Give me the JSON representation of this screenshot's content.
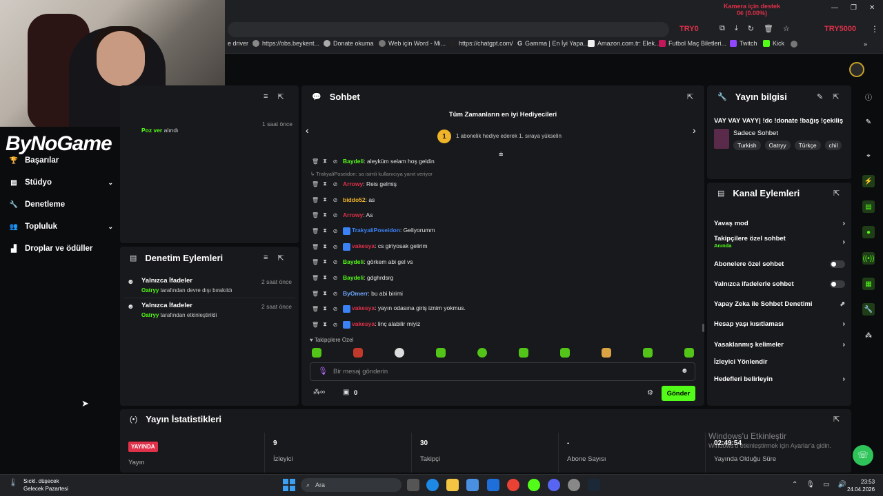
{
  "browser": {
    "notification_line1": "Kamera için destek",
    "notification_line2": "0¢ (0.00%)",
    "overlay_left": "TRY0",
    "overlay_right": "TRY5000",
    "bookmarks": [
      "e driver",
      "https://obs.beykent...",
      "Donate okuma",
      "Web için Word - Mi...",
      "https://chatgpt.com/",
      "Gamma | En İyi Yapa...",
      "Amazon.com.tr: Elek...",
      "Futbol Maç Biletleri...",
      "Twitch",
      "Kick"
    ]
  },
  "sidebar": {
    "logo": "ByNoGame",
    "items": [
      {
        "label": "Başarılar",
        "icon": "trophy-icon"
      },
      {
        "label": "Stüdyo",
        "icon": "studio-icon",
        "chevron": true
      },
      {
        "label": "Denetleme",
        "icon": "wrench-icon"
      },
      {
        "label": "Topluluk",
        "icon": "community-icon",
        "chevron": true
      },
      {
        "label": "Droplar ve ödüller",
        "icon": "drops-icon"
      }
    ]
  },
  "top_left_panel": {
    "event_action": "Poz ver",
    "event_suffix": " alındı",
    "time": "1 saat önce"
  },
  "moderation": {
    "title": "Denetim Eylemleri",
    "items": [
      {
        "title": "Yalnızca İfadeler",
        "actor": "Oatryy",
        "action": " tarafından devre dışı bırakıldı",
        "time": "2 saat önce"
      },
      {
        "title": "Yalnızca İfadeler",
        "actor": "Oatryy",
        "action": " tarafından etkinleştirildi",
        "time": "2 saat önce"
      }
    ]
  },
  "chat": {
    "title": "Sohbet",
    "gifters_title": "Tüm Zamanların en iyi Hediyecileri",
    "gifters_rank": "1",
    "gifters_sub": "1 abonelik hediye ederek 1. sıraya yükselin",
    "reply_note": "TrakyaliPoseidon: sa isimli kullanıcıya yanıt veriyor",
    "messages": [
      {
        "user": "Baydeli",
        "color": "#53fc18",
        "text": ": aleyküm selam hoş geldin"
      },
      {
        "user": "Arrowy",
        "color": "#e0314b",
        "text": ": Reis gelmiş"
      },
      {
        "user": "biddo52",
        "color": "#f0b429",
        "text": ": as"
      },
      {
        "user": "Arrowy",
        "color": "#e0314b",
        "text": ": As"
      },
      {
        "user": "TrakyaliPoseidon",
        "color": "#3b82f6",
        "text": ": Geliyorumm",
        "badge": true
      },
      {
        "user": "vakesya",
        "color": "#e0314b",
        "text": ": cs giriyosak gelirim",
        "badge": true
      },
      {
        "user": "Baydeli",
        "color": "#53fc18",
        "text": ": görkem abi gel vs"
      },
      {
        "user": "Baydeli",
        "color": "#53fc18",
        "text": ": gdghrdsrg"
      },
      {
        "user": "ByOmerr",
        "color": "#6ea8ff",
        "text": ": bu abi birimi"
      },
      {
        "user": "vakesya",
        "color": "#e0314b",
        "text": ": yayın odasına giriş iznim yokmus.",
        "badge": true
      },
      {
        "user": "vakesya",
        "color": "#e0314b",
        "text": ": linç alabilir miyiz",
        "badge": true
      }
    ],
    "followers_only_label": "Takipçilere Özel",
    "input_placeholder": "Bir mesaj gönderin",
    "points_value": "0",
    "send_label": "Gönder"
  },
  "stream_info": {
    "title": "Yayın bilgisi",
    "stream_title": "VAY VAY VAYY| !dc !donate !bağış !çekiliş",
    "category": "Sadece Sohbet",
    "tags": [
      "Turkish",
      "Oatryy",
      "Türkçe",
      "chil"
    ]
  },
  "channel_actions": {
    "title": "Kanal Eylemleri",
    "items": [
      {
        "label": "Yavaş mod",
        "control": "chevron"
      },
      {
        "label": "Takipçilere özel sohbet",
        "sub": "Anında",
        "control": "chevron"
      },
      {
        "label": "Abonelere özel sohbet",
        "control": "toggle"
      },
      {
        "label": "Yalnızca ifadelerle sohbet",
        "control": "toggle"
      },
      {
        "label": "Yapay Zeka ile Sohbet Denetimi",
        "control": "external"
      },
      {
        "label": "Hesap yaşı kısıtlaması",
        "control": "chevron"
      },
      {
        "label": "Yasaklanmış kelimeler",
        "control": "chevron"
      },
      {
        "label": "İzleyici Yönlendir",
        "control": "none"
      },
      {
        "label": "Hedefleri belirleyin",
        "control": "chevron"
      }
    ]
  },
  "stats": {
    "title": "Yayın İstatistikleri",
    "live_badge": "YAYINDA",
    "cols": [
      {
        "value": "",
        "label": "Yayın"
      },
      {
        "value": "9",
        "label": "İzleyici"
      },
      {
        "value": "30",
        "label": "Takipçi"
      },
      {
        "value": "-",
        "label": "Abone Sayısı"
      },
      {
        "value": "02:49:54",
        "label": "Yayında Olduğu Süre"
      }
    ]
  },
  "windows": {
    "watermark1": "Windows'u Etkinleştir",
    "watermark2": "Windows'u etkinleştirmek için Ayarlar'a gidin.",
    "weather_line1": "Sıckl. düşecek",
    "weather_line2": "Gelecek Pazartesi",
    "search": "Ara",
    "time": "23:53",
    "date": "24.04.2026"
  }
}
